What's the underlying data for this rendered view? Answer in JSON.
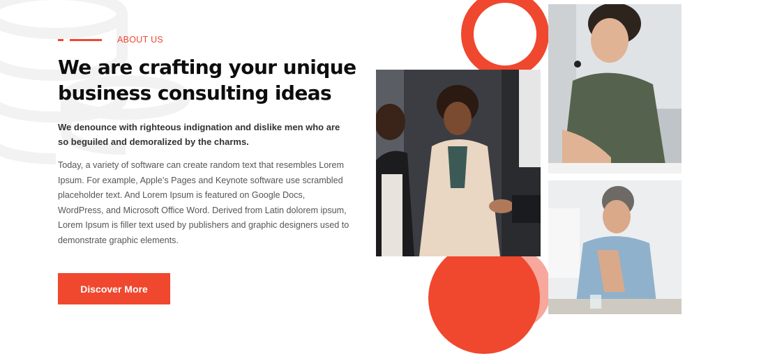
{
  "about": {
    "eyebrow": "ABOUT US",
    "heading": "We are crafting your unique business consulting ideas",
    "lead": "We denounce with righteous indignation and dislike men who are so beguiled and demoralized by the charms.",
    "body": "Today, a variety of software can create random text that resembles Lorem Ipsum. For example, Apple’s Pages and Keynote software use scrambled placeholder text. And Lorem Ipsum is featured on Google Docs, WordPress, and Microsoft Office Word. Derived from Latin dolorem ipsum, Lorem Ipsum is filler text used by publishers and graphic designers used to demonstrate graphic elements.",
    "cta": "Discover More"
  },
  "colors": {
    "accent": "#f0472f",
    "accent_pale": "#f7a79c"
  },
  "icons": {
    "watermark": "database-icon"
  }
}
